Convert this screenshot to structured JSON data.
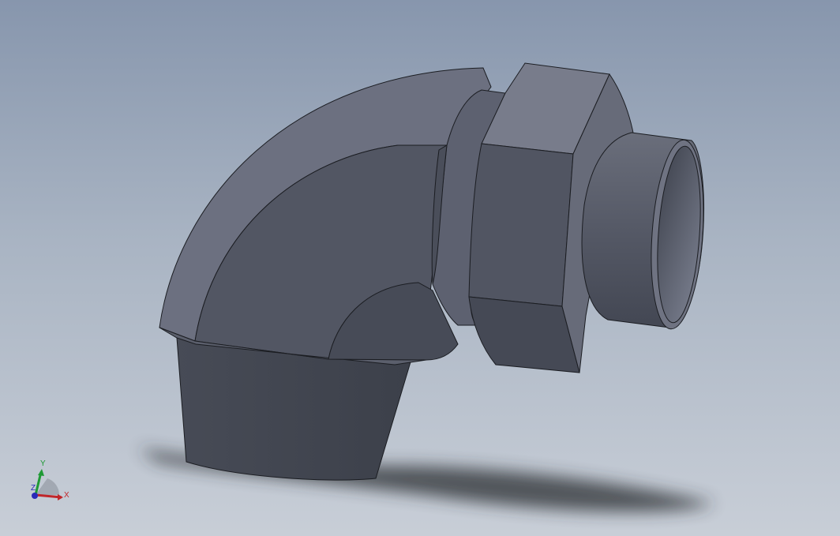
{
  "viewport": {
    "background_top": "#8796ad",
    "background_bottom": "#c8ced7",
    "model_color": "#525663"
  },
  "triad": {
    "x_label": "X",
    "y_label": "Y",
    "z_label": "Z",
    "x_color": "#c0262a",
    "y_color": "#1f9a35",
    "z_color": "#2a2ab8"
  }
}
